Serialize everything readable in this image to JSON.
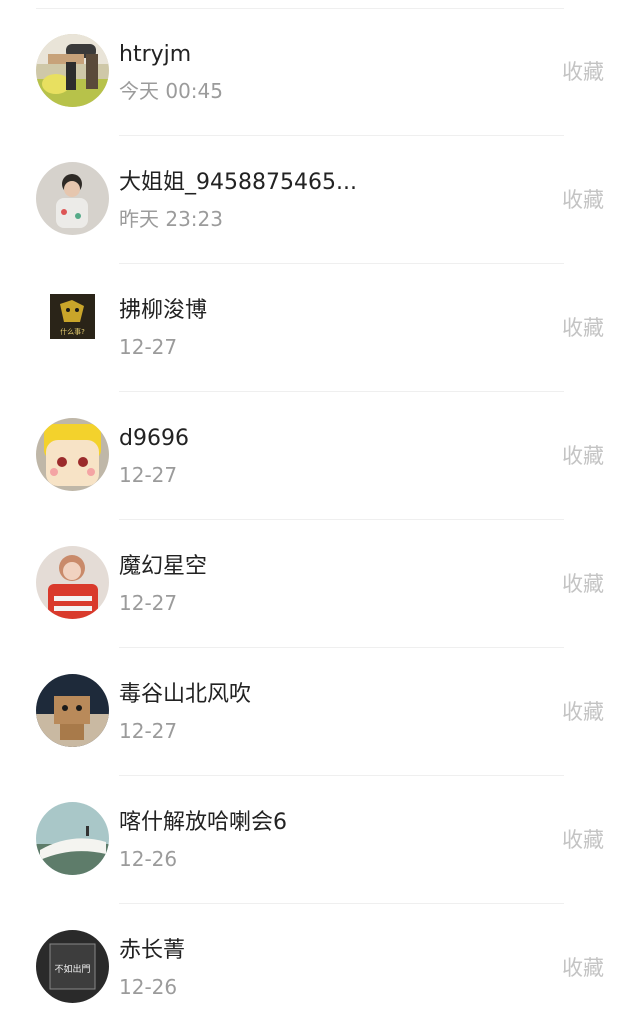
{
  "items": [
    {
      "name": "htryjm",
      "time": "今天 00:45",
      "action": "收藏",
      "icon": "avatar-photo-person-icon"
    },
    {
      "name": "大姐姐_9458875465...",
      "time": "昨天 23:23",
      "action": "收藏",
      "icon": "avatar-photo-child-icon"
    },
    {
      "name": "拂柳浚博",
      "time": "12-27",
      "action": "收藏",
      "icon": "avatar-cartoon-square-icon",
      "avatar_text": "什么事?"
    },
    {
      "name": "d9696",
      "time": "12-27",
      "action": "收藏",
      "icon": "avatar-cartoon-face-icon"
    },
    {
      "name": "魔幻星空",
      "time": "12-27",
      "action": "收藏",
      "icon": "avatar-photo-girl-icon"
    },
    {
      "name": "毒谷山北风吹",
      "time": "12-27",
      "action": "收藏",
      "icon": "avatar-danbo-icon"
    },
    {
      "name": "喀什解放哈喇会6",
      "time": "12-26",
      "action": "收藏",
      "icon": "avatar-landscape-icon"
    },
    {
      "name": "赤长菁",
      "time": "12-26",
      "action": "收藏",
      "icon": "avatar-calligraphy-icon",
      "avatar_text": "不如出門"
    }
  ],
  "colors": {
    "name": "#222222",
    "time": "#9b9b9b",
    "action": "#c4c4c4",
    "divider": "#efefef"
  }
}
